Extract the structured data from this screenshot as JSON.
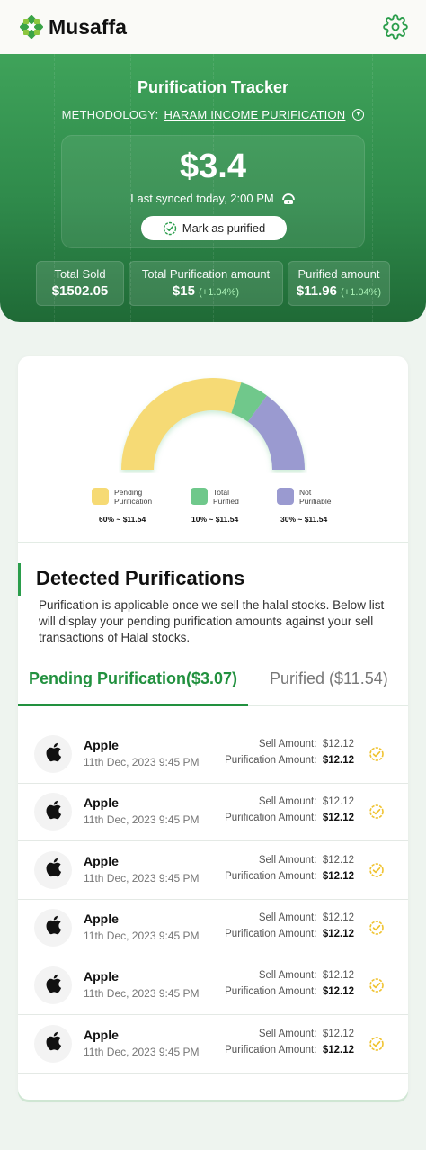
{
  "app": {
    "name": "Musaffa"
  },
  "colors": {
    "brand_green": "#2f8a4b",
    "accent_green": "#22913f",
    "pending": "#f6da74",
    "purified": "#6fc88b",
    "not_purifiable": "#9a9ad0",
    "check_yellow": "#f0c330"
  },
  "hero": {
    "title": "Purification Tracker",
    "methodology_label": "METHODOLOGY:",
    "methodology_value": "HARAM INCOME PURIFICATION",
    "amount": "$3.4",
    "synced": "Last synced today, 2:00 PM",
    "mark_button": "Mark as purified",
    "stats": [
      {
        "label": "Total Sold",
        "value": "$1502.05",
        "pct": ""
      },
      {
        "label": "Total Purification amount",
        "value": "$15",
        "pct": "(+1.04%)"
      },
      {
        "label": "Purified amount",
        "value": "$11.96",
        "pct": "(+1.04%)"
      }
    ]
  },
  "chart_data": {
    "type": "pie",
    "variant": "semi-donut",
    "slices": [
      {
        "label": "Pending Purification",
        "percent": 60,
        "amount": "$11.54",
        "color": "#f6da74"
      },
      {
        "label": "Total Purified",
        "percent": 10,
        "amount": "$11.54",
        "color": "#6fc88b"
      },
      {
        "label": "Not Purifiable",
        "percent": 30,
        "amount": "$11.54",
        "color": "#9a9ad0"
      }
    ]
  },
  "legend": [
    {
      "line1": "Pending",
      "line2": "Purification",
      "value": "60% ~ $11.54"
    },
    {
      "line1": "Total",
      "line2": "Purified",
      "value": "10% ~ $11.54"
    },
    {
      "line1": "Not",
      "line2": "Purifiable",
      "value": "30% ~ $11.54"
    }
  ],
  "detected": {
    "title": "Detected Purifications",
    "description": "Purification is applicable once we sell the halal stocks. Below list will display your pending purification amounts against your sell transactions of Halal stocks."
  },
  "tabs": {
    "pending": "Pending Purification($3.07)",
    "purified": "Purified ($11.54)"
  },
  "list_labels": {
    "sell": "Sell Amount:",
    "purification": "Purification Amount:"
  },
  "transactions": [
    {
      "name": "Apple",
      "date": "11th Dec, 2023 9:45 PM",
      "sell": "$12.12",
      "purification": "$12.12"
    },
    {
      "name": "Apple",
      "date": "11th Dec, 2023 9:45 PM",
      "sell": "$12.12",
      "purification": "$12.12"
    },
    {
      "name": "Apple",
      "date": "11th Dec, 2023 9:45 PM",
      "sell": "$12.12",
      "purification": "$12.12"
    },
    {
      "name": "Apple",
      "date": "11th Dec, 2023 9:45 PM",
      "sell": "$12.12",
      "purification": "$12.12"
    },
    {
      "name": "Apple",
      "date": "11th Dec, 2023 9:45 PM",
      "sell": "$12.12",
      "purification": "$12.12"
    },
    {
      "name": "Apple",
      "date": "11th Dec, 2023 9:45 PM",
      "sell": "$12.12",
      "purification": "$12.12"
    }
  ]
}
